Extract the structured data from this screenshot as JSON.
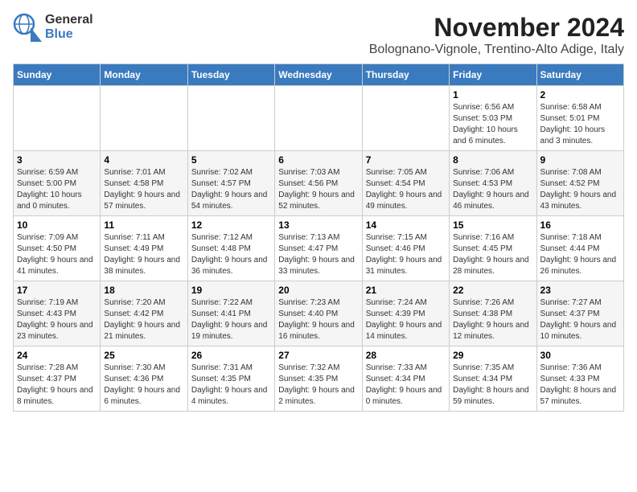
{
  "logo": {
    "line1": "General",
    "line2": "Blue"
  },
  "header": {
    "month": "November 2024",
    "location": "Bolognano-Vignole, Trentino-Alto Adige, Italy"
  },
  "weekdays": [
    "Sunday",
    "Monday",
    "Tuesday",
    "Wednesday",
    "Thursday",
    "Friday",
    "Saturday"
  ],
  "weeks": [
    [
      {
        "day": "",
        "info": ""
      },
      {
        "day": "",
        "info": ""
      },
      {
        "day": "",
        "info": ""
      },
      {
        "day": "",
        "info": ""
      },
      {
        "day": "",
        "info": ""
      },
      {
        "day": "1",
        "info": "Sunrise: 6:56 AM\nSunset: 5:03 PM\nDaylight: 10 hours and 6 minutes."
      },
      {
        "day": "2",
        "info": "Sunrise: 6:58 AM\nSunset: 5:01 PM\nDaylight: 10 hours and 3 minutes."
      }
    ],
    [
      {
        "day": "3",
        "info": "Sunrise: 6:59 AM\nSunset: 5:00 PM\nDaylight: 10 hours and 0 minutes."
      },
      {
        "day": "4",
        "info": "Sunrise: 7:01 AM\nSunset: 4:58 PM\nDaylight: 9 hours and 57 minutes."
      },
      {
        "day": "5",
        "info": "Sunrise: 7:02 AM\nSunset: 4:57 PM\nDaylight: 9 hours and 54 minutes."
      },
      {
        "day": "6",
        "info": "Sunrise: 7:03 AM\nSunset: 4:56 PM\nDaylight: 9 hours and 52 minutes."
      },
      {
        "day": "7",
        "info": "Sunrise: 7:05 AM\nSunset: 4:54 PM\nDaylight: 9 hours and 49 minutes."
      },
      {
        "day": "8",
        "info": "Sunrise: 7:06 AM\nSunset: 4:53 PM\nDaylight: 9 hours and 46 minutes."
      },
      {
        "day": "9",
        "info": "Sunrise: 7:08 AM\nSunset: 4:52 PM\nDaylight: 9 hours and 43 minutes."
      }
    ],
    [
      {
        "day": "10",
        "info": "Sunrise: 7:09 AM\nSunset: 4:50 PM\nDaylight: 9 hours and 41 minutes."
      },
      {
        "day": "11",
        "info": "Sunrise: 7:11 AM\nSunset: 4:49 PM\nDaylight: 9 hours and 38 minutes."
      },
      {
        "day": "12",
        "info": "Sunrise: 7:12 AM\nSunset: 4:48 PM\nDaylight: 9 hours and 36 minutes."
      },
      {
        "day": "13",
        "info": "Sunrise: 7:13 AM\nSunset: 4:47 PM\nDaylight: 9 hours and 33 minutes."
      },
      {
        "day": "14",
        "info": "Sunrise: 7:15 AM\nSunset: 4:46 PM\nDaylight: 9 hours and 31 minutes."
      },
      {
        "day": "15",
        "info": "Sunrise: 7:16 AM\nSunset: 4:45 PM\nDaylight: 9 hours and 28 minutes."
      },
      {
        "day": "16",
        "info": "Sunrise: 7:18 AM\nSunset: 4:44 PM\nDaylight: 9 hours and 26 minutes."
      }
    ],
    [
      {
        "day": "17",
        "info": "Sunrise: 7:19 AM\nSunset: 4:43 PM\nDaylight: 9 hours and 23 minutes."
      },
      {
        "day": "18",
        "info": "Sunrise: 7:20 AM\nSunset: 4:42 PM\nDaylight: 9 hours and 21 minutes."
      },
      {
        "day": "19",
        "info": "Sunrise: 7:22 AM\nSunset: 4:41 PM\nDaylight: 9 hours and 19 minutes."
      },
      {
        "day": "20",
        "info": "Sunrise: 7:23 AM\nSunset: 4:40 PM\nDaylight: 9 hours and 16 minutes."
      },
      {
        "day": "21",
        "info": "Sunrise: 7:24 AM\nSunset: 4:39 PM\nDaylight: 9 hours and 14 minutes."
      },
      {
        "day": "22",
        "info": "Sunrise: 7:26 AM\nSunset: 4:38 PM\nDaylight: 9 hours and 12 minutes."
      },
      {
        "day": "23",
        "info": "Sunrise: 7:27 AM\nSunset: 4:37 PM\nDaylight: 9 hours and 10 minutes."
      }
    ],
    [
      {
        "day": "24",
        "info": "Sunrise: 7:28 AM\nSunset: 4:37 PM\nDaylight: 9 hours and 8 minutes."
      },
      {
        "day": "25",
        "info": "Sunrise: 7:30 AM\nSunset: 4:36 PM\nDaylight: 9 hours and 6 minutes."
      },
      {
        "day": "26",
        "info": "Sunrise: 7:31 AM\nSunset: 4:35 PM\nDaylight: 9 hours and 4 minutes."
      },
      {
        "day": "27",
        "info": "Sunrise: 7:32 AM\nSunset: 4:35 PM\nDaylight: 9 hours and 2 minutes."
      },
      {
        "day": "28",
        "info": "Sunrise: 7:33 AM\nSunset: 4:34 PM\nDaylight: 9 hours and 0 minutes."
      },
      {
        "day": "29",
        "info": "Sunrise: 7:35 AM\nSunset: 4:34 PM\nDaylight: 8 hours and 59 minutes."
      },
      {
        "day": "30",
        "info": "Sunrise: 7:36 AM\nSunset: 4:33 PM\nDaylight: 8 hours and 57 minutes."
      }
    ]
  ]
}
